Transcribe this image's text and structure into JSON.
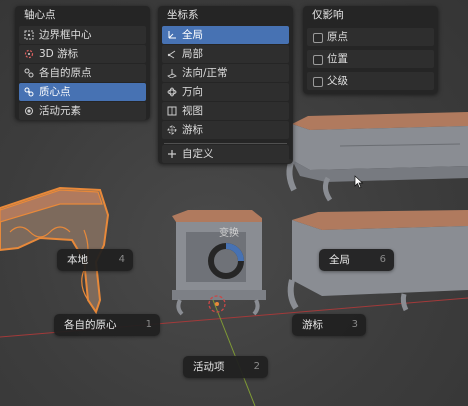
{
  "pivot_panel": {
    "title": "轴心点",
    "items": [
      {
        "label": "边界框中心",
        "icon": "bounding-box-center-icon",
        "active": false
      },
      {
        "label": "3D 游标",
        "icon": "3d-cursor-icon",
        "active": false
      },
      {
        "label": "各自的原点",
        "icon": "individual-origins-icon",
        "active": false
      },
      {
        "label": "质心点",
        "icon": "median-point-icon",
        "active": true
      },
      {
        "label": "活动元素",
        "icon": "active-element-icon",
        "active": false
      }
    ]
  },
  "orientation_panel": {
    "title": "坐标系",
    "items": [
      {
        "label": "全局",
        "icon": "global-axes-icon",
        "active": true
      },
      {
        "label": "局部",
        "icon": "local-axes-icon",
        "active": false
      },
      {
        "label": "法向/正常",
        "icon": "normal-icon",
        "active": false
      },
      {
        "label": "万向",
        "icon": "gimbal-icon",
        "active": false
      },
      {
        "label": "视图",
        "icon": "view-icon",
        "active": false
      },
      {
        "label": "游标",
        "icon": "cursor-orientation-icon",
        "active": false
      }
    ],
    "add_label": "自定义",
    "add_icon": "plus-icon"
  },
  "affect_panel": {
    "title": "仅影响",
    "items": [
      {
        "label": "原点",
        "checked": false
      },
      {
        "label": "位置",
        "checked": false
      },
      {
        "label": "父级",
        "checked": false
      }
    ]
  },
  "pie_menu": {
    "title": "变换",
    "items": [
      {
        "label": "本地",
        "key": "4"
      },
      {
        "label": "全局",
        "key": "6"
      },
      {
        "label": "各自的原心",
        "key": "1"
      },
      {
        "label": "游标",
        "key": "3"
      },
      {
        "label": "活动项",
        "key": "2"
      }
    ]
  },
  "colors": {
    "accent": "#4772b3",
    "selection_outline": "#e8893a",
    "furniture_wood": "#b07a5e",
    "furniture_body": "#8a8d93"
  }
}
